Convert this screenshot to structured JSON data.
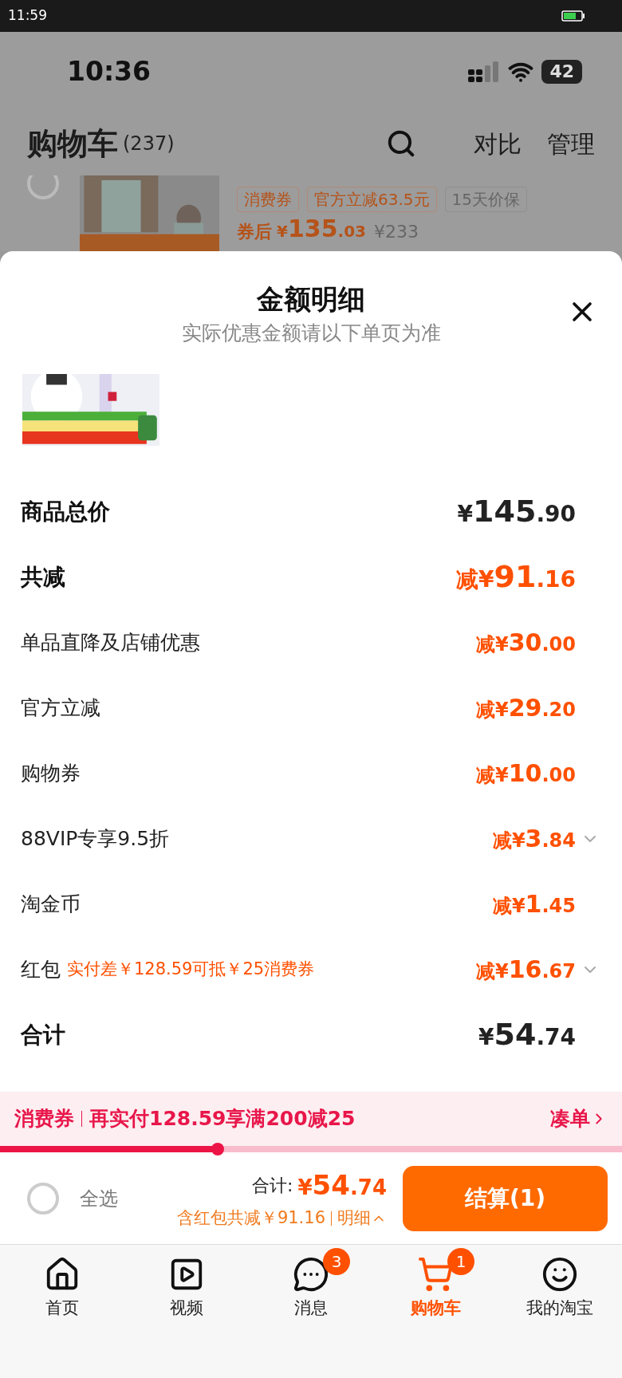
{
  "system_status": {
    "time": "11:59"
  },
  "phone_status": {
    "time": "10:36",
    "battery": "42"
  },
  "cart_header": {
    "title": "购物车",
    "count": "(237)",
    "actions": [
      "对比",
      "管理"
    ]
  },
  "background_item": {
    "kind": "picture",
    "tags": [
      "消费券",
      "官方立减63.5元",
      "15天价保"
    ],
    "price_label": "券后",
    "price": "¥135.03",
    "original_price": "¥233"
  },
  "sheet": {
    "title": "金额明细",
    "subtitle": "实际优惠金额请以下单页为准",
    "rows": [
      {
        "kind": "total",
        "label": "商品总价",
        "amount": "¥145.90"
      },
      {
        "kind": "discount_total",
        "label": "共减",
        "amount": "减¥91.16"
      },
      {
        "kind": "discount",
        "label": "单品直降及店铺优惠",
        "amount": "减¥30.00"
      },
      {
        "kind": "discount",
        "label": "官方立减",
        "amount": "减¥29.20"
      },
      {
        "kind": "discount",
        "label": "购物券",
        "amount": "减¥10.00"
      },
      {
        "kind": "discount_expandable",
        "label": "88VIP专享9.5折",
        "amount": "减¥3.84"
      },
      {
        "kind": "discount",
        "label": "淘金币",
        "amount": "减¥1.45"
      },
      {
        "kind": "discount_expandable",
        "label": "红包",
        "note": "实付差￥128.59可抵￥25消费券",
        "amount": "减¥16.67"
      },
      {
        "kind": "sum",
        "label": "合计",
        "amount": "¥54.74"
      }
    ]
  },
  "promo": {
    "tag": "消费券",
    "text": "再实付128.59享满200减25",
    "link": "凑单",
    "level": 0.35
  },
  "checkout_bar": {
    "select_all": {
      "label": "全选",
      "checked": false
    },
    "total_label": "合计:",
    "total": "¥54.74",
    "savings": "含红包共减￥91.16",
    "details": "明细",
    "button": "结算(1)"
  },
  "tab_bar": [
    {
      "label": "首页",
      "selected": false
    },
    {
      "label": "视频",
      "selected": false
    },
    {
      "label": "消息",
      "badge": "3",
      "selected": false
    },
    {
      "label": "购物车",
      "badge": "1",
      "selected": true
    },
    {
      "label": "我的淘宝",
      "selected": false
    }
  ]
}
